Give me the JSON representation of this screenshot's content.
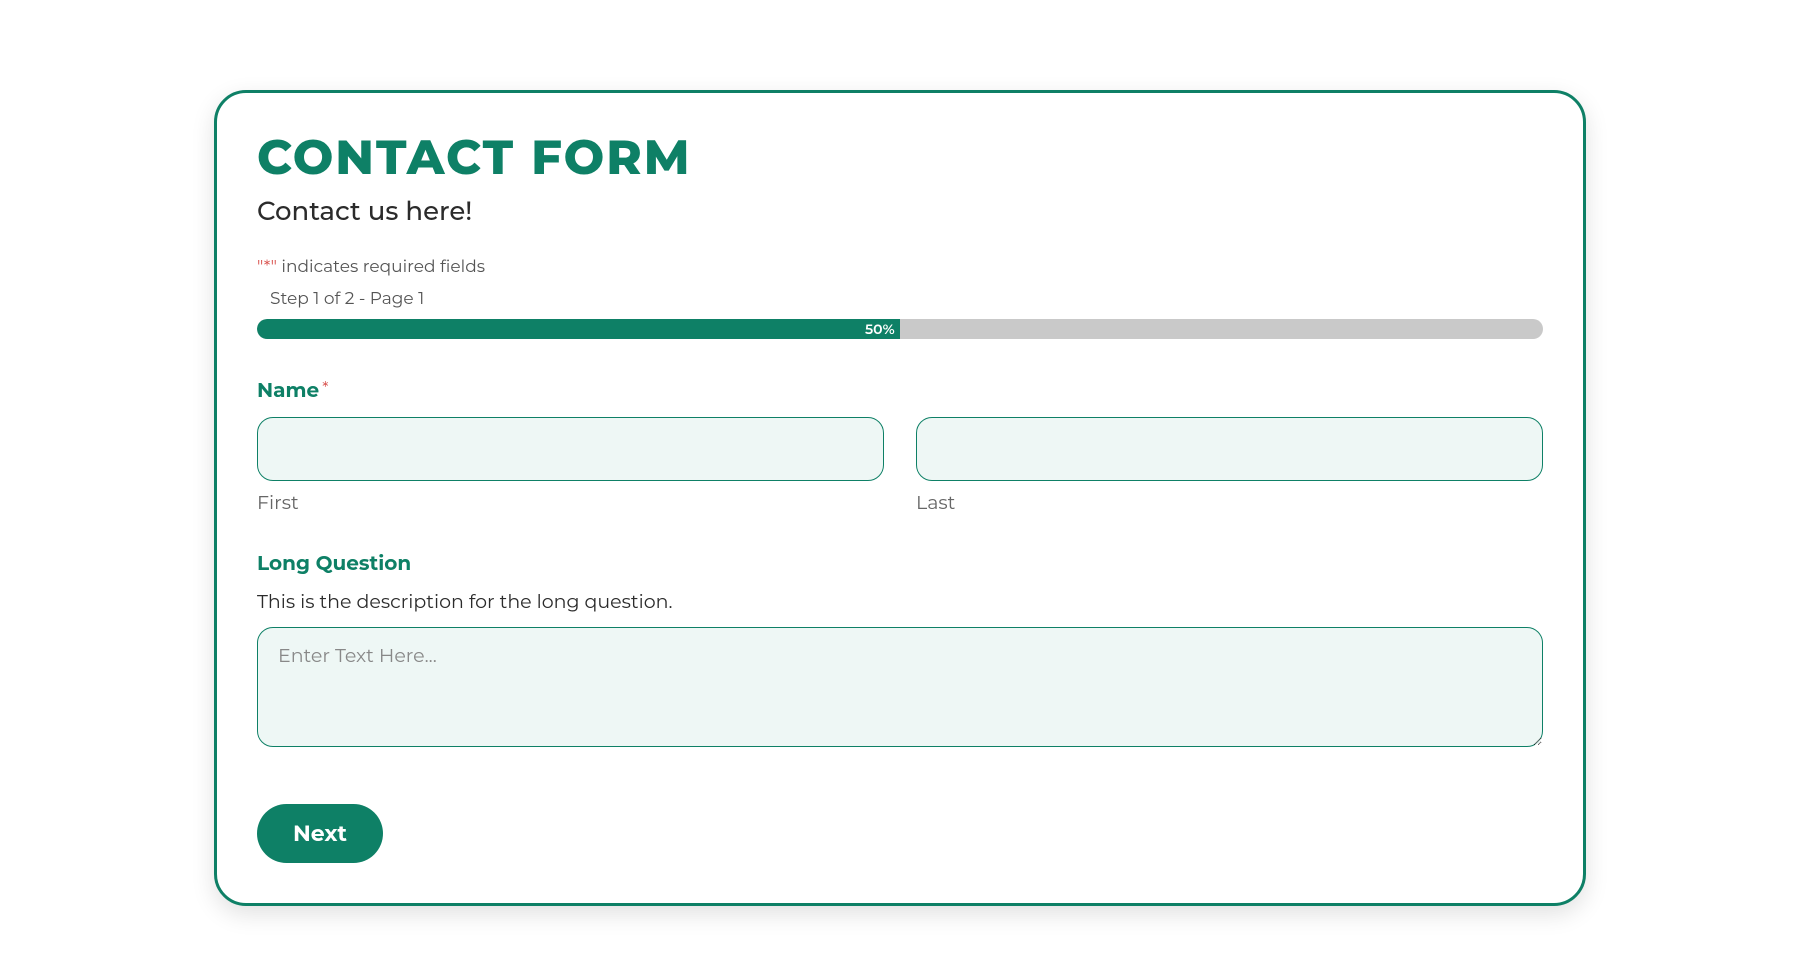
{
  "form": {
    "title": "CONTACT FORM",
    "subtitle": "Contact us here!",
    "required_note_prefix": "\"",
    "required_note_asterisk": "*",
    "required_note_suffix": "\" indicates required fields",
    "step_label": "Step 1 of 2 - Page 1",
    "progress": {
      "percent_text": "50%",
      "percent_value": 50
    },
    "fields": {
      "name": {
        "label": "Name",
        "required_mark": "*",
        "first_sublabel": "First",
        "last_sublabel": "Last",
        "first_value": "",
        "last_value": ""
      },
      "long_question": {
        "label": "Long Question",
        "description": "This is the description for the long question.",
        "placeholder": "Enter Text Here...",
        "value": ""
      }
    },
    "next_button": "Next"
  }
}
